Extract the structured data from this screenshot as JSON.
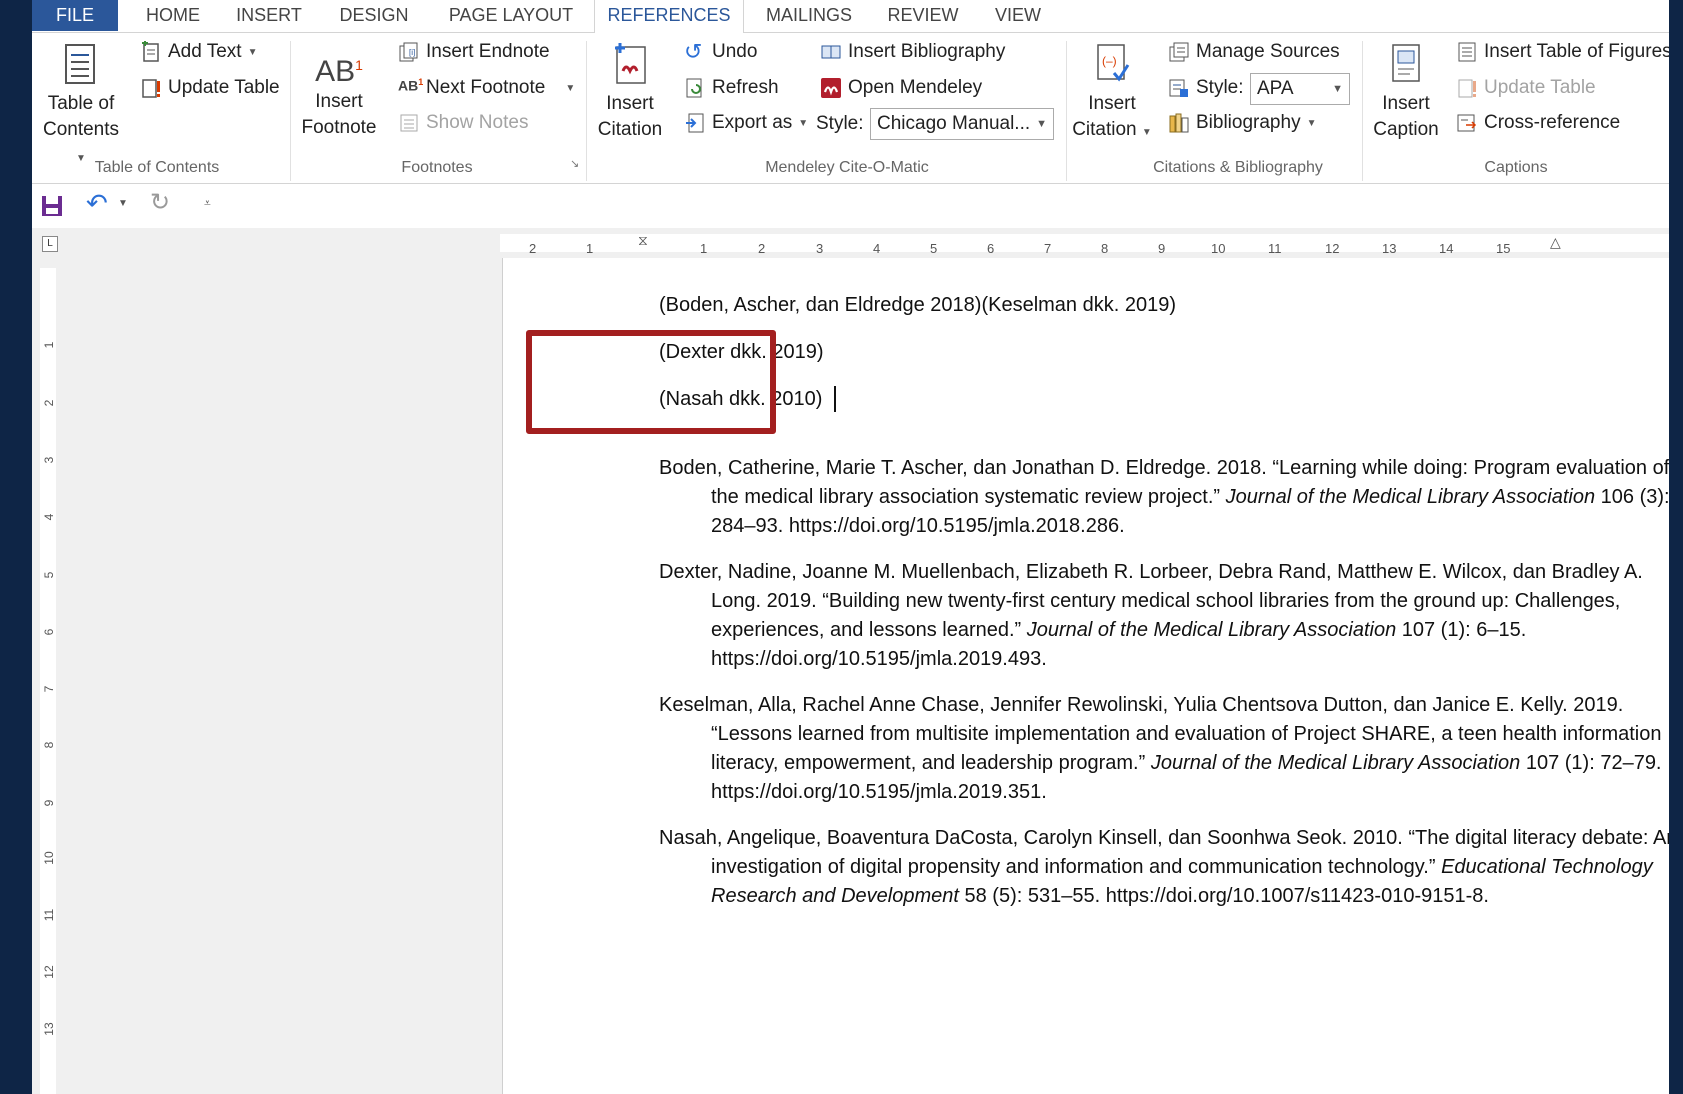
{
  "tabs": [
    "FILE",
    "HOME",
    "INSERT",
    "DESIGN",
    "PAGE LAYOUT",
    "REFERENCES",
    "MAILINGS",
    "REVIEW",
    "VIEW"
  ],
  "ribbon": {
    "toc": {
      "button_line1": "Table of",
      "button_line2": "Contents",
      "add_text": "Add Text",
      "update_table": "Update Table",
      "group_label": "Table of Contents"
    },
    "footnotes": {
      "insert_line1": "Insert",
      "insert_line2": "Footnote",
      "insert_endnote": "Insert Endnote",
      "next_footnote": "Next Footnote",
      "show_notes": "Show Notes",
      "group_label": "Footnotes"
    },
    "mendeley": {
      "insert_line1": "Insert",
      "insert_line2": "Citation",
      "undo": "Undo",
      "refresh": "Refresh",
      "export_as": "Export as",
      "insert_bibliography": "Insert Bibliography",
      "open_mendeley": "Open Mendeley",
      "style_label": "Style:",
      "style_value": "Chicago Manual...",
      "group_label": "Mendeley Cite-O-Matic"
    },
    "citations": {
      "insert_line1": "Insert",
      "insert_line2": "Citation",
      "manage_sources": "Manage Sources",
      "style_label": "Style:",
      "style_value": "APA",
      "bibliography": "Bibliography",
      "group_label": "Citations & Bibliography"
    },
    "captions": {
      "insert_line1": "Insert",
      "insert_line2": "Caption",
      "insert_table_of_figures": "Insert Table of Figures",
      "update_table": "Update Table",
      "cross_reference": "Cross-reference",
      "group_label": "Captions"
    }
  },
  "ruler": {
    "h_left": [
      "2",
      "1"
    ],
    "h_right": [
      "1",
      "2",
      "3",
      "4",
      "5",
      "6",
      "7",
      "8",
      "9",
      "10",
      "11",
      "12",
      "13",
      "14",
      "15"
    ],
    "v": [
      "1",
      "2",
      "3",
      "4",
      "5",
      "6",
      "7",
      "8",
      "9",
      "10",
      "11",
      "12",
      "13"
    ]
  },
  "document": {
    "citations": [
      "(Boden, Ascher, dan Eldredge 2018)(Keselman dkk. 2019)",
      "(Dexter dkk. 2019)",
      "(Nasah dkk. 2010)"
    ],
    "bibliography": [
      {
        "pre": "Boden, Catherine, Marie T. Ascher, dan Jonathan D. Eldredge. 2018. “Learning while doing: Program evaluation of the medical library association systematic review project.” ",
        "journal": "Journal of the Medical Library Association",
        "post": " 106 (3): 284–93. https://doi.org/10.5195/jmla.2018.286."
      },
      {
        "pre": "Dexter, Nadine, Joanne M. Muellenbach, Elizabeth R. Lorbeer, Debra Rand, Matthew E. Wilcox, dan Bradley A. Long. 2019. “Building new twenty-first century medical school libraries from the ground up: Challenges, experiences, and lessons learned.” ",
        "journal": "Journal of the Medical Library Association",
        "post": " 107 (1): 6–15. https://doi.org/10.5195/jmla.2019.493."
      },
      {
        "pre": "Keselman, Alla, Rachel Anne Chase, Jennifer Rewolinski, Yulia Chentsova Dutton, dan Janice E. Kelly. 2019. “Lessons learned from multisite implementation and evaluation of Project SHARE, a teen health information literacy, empowerment, and leadership program.” ",
        "journal": "Journal of the Medical Library Association",
        "post": " 107 (1): 72–79. https://doi.org/10.5195/jmla.2019.351."
      },
      {
        "pre": "Nasah, Angelique, Boaventura DaCosta, Carolyn Kinsell, dan Soonhwa Seok. 2010. “The digital literacy debate: An investigation of digital propensity and information and communication technology.” ",
        "journal": "Educational Technology Research and Development",
        "post": " 58 (5): 531–55. https://doi.org/10.1007/s11423-010-9151-8."
      }
    ]
  },
  "colors": {
    "file_tab": "#2b579a",
    "active_tab_text": "#2b579a",
    "highlight_box": "#a31f1f",
    "background_frame": "#0e2546",
    "mendeley_red": "#b21f2d"
  }
}
